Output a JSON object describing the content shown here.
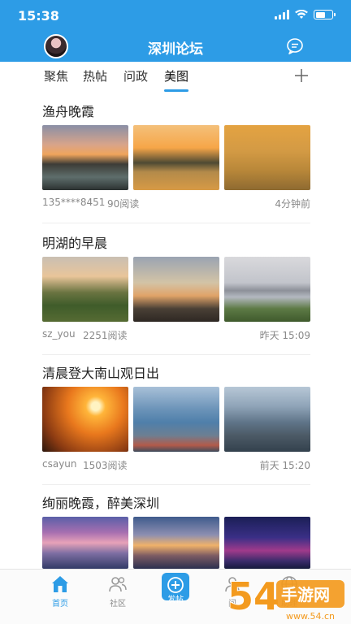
{
  "status_bar": {
    "time": "15:38"
  },
  "header": {
    "title": "深圳论坛"
  },
  "tabs": [
    {
      "label": "聚焦"
    },
    {
      "label": "热帖"
    },
    {
      "label": "问政"
    },
    {
      "label": "美图"
    }
  ],
  "active_tab": "美图",
  "posts": [
    {
      "title": "渔舟晚霞",
      "author": "135****8451",
      "reads": "90阅读",
      "time": "4分钟前"
    },
    {
      "title": "明湖的早晨",
      "author": "sz_you",
      "reads": "2251阅读",
      "time": "昨天 15:09"
    },
    {
      "title": "清晨登大南山观日出",
      "author": "csayun",
      "reads": "1503阅读",
      "time": "前天 15:20"
    },
    {
      "title": "绚丽晚霞，醉美深圳"
    }
  ],
  "bottom_nav": [
    {
      "label": "首页"
    },
    {
      "label": "社区"
    },
    {
      "label": "发帖"
    },
    {
      "label": "问"
    },
    {
      "label": "助理"
    }
  ],
  "watermark": {
    "text": "54 手游网",
    "url": "www.54.cn"
  },
  "colors": {
    "brand": "#2d9ce6",
    "text": "#222222",
    "meta": "#888888"
  }
}
